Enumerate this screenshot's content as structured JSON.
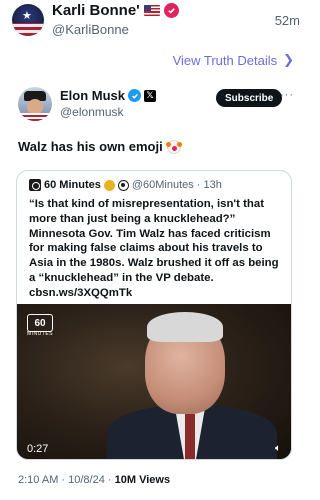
{
  "outer_post": {
    "display_name": "Karli Bonne'",
    "handle": "@KarliBonne",
    "time": "52m",
    "details_link": "View Truth Details"
  },
  "embedded_post": {
    "display_name": "Elon Musk",
    "handle": "@elonmusk",
    "subscribe_label": "Subscribe",
    "text": "Walz has his own emoji",
    "timestamp": "2:10 AM · 10/8/24 ·",
    "views_count": "10M",
    "views_label": "Views"
  },
  "quoted_post": {
    "display_name": "60 Minutes",
    "handle": "@60Minutes",
    "time": "· 13h",
    "body": "“Is that kind of misrepresentation, isn't that more than just being a knucklehead?” Minnesota Gov. Tim Walz has faced criticism for making false claims about his travels to Asia in the 1980s. Walz brushed it off as being a “knucklehead” in the VP debate. cbsn.ws/3XQQmTk",
    "video_logo": "60",
    "video_logo_sub": "MINUTES",
    "video_duration": "0:27"
  },
  "colors": {
    "link": "#6a6fd6",
    "verified_blue": "#1d9bf0",
    "verified_red": "#e0245e",
    "gold_check": "#e8b321"
  },
  "icons": [
    "us-flag-icon",
    "verified-badge-icon",
    "chevron-right-icon",
    "x-logo-icon",
    "more-icon",
    "clown-emoji-icon",
    "cbs-eye-icon",
    "sound-icon"
  ]
}
